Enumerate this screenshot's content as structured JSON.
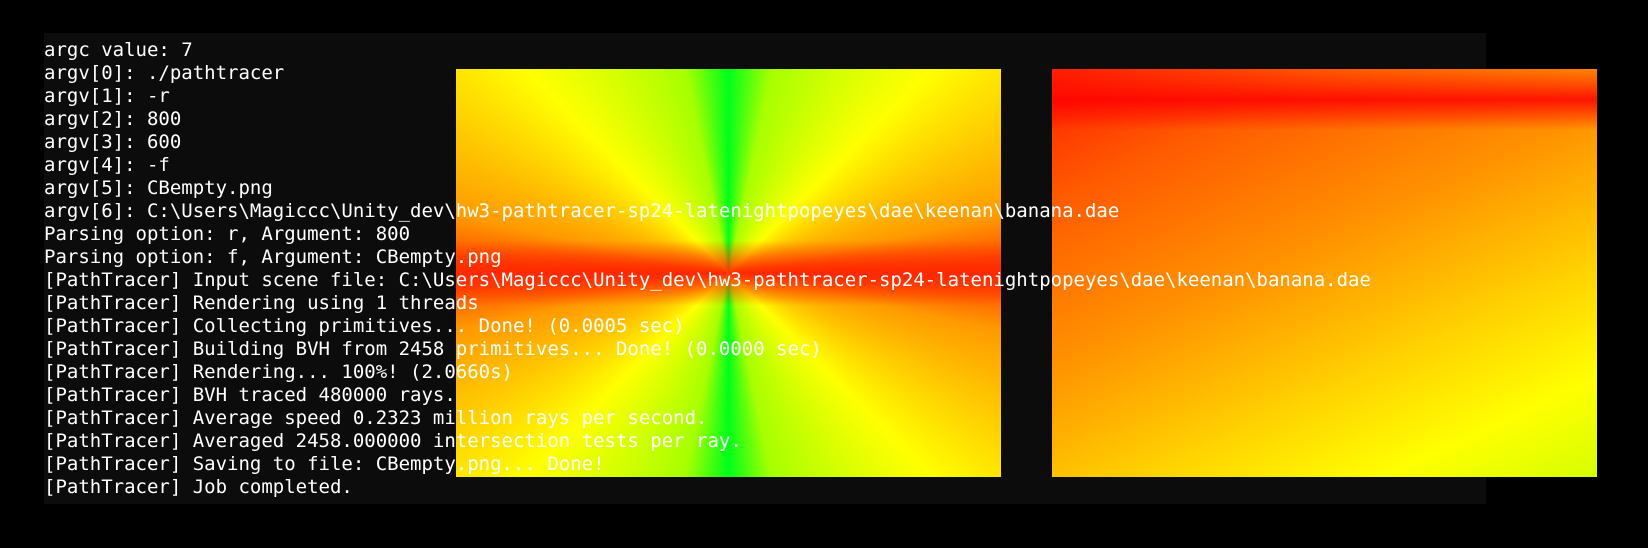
{
  "terminal": {
    "lines": [
      "argc value: 7",
      "argv[0]: ./pathtracer",
      "argv[1]: -r",
      "argv[2]: 800",
      "argv[3]: 600",
      "argv[4]: -f",
      "argv[5]: CBempty.png",
      "argv[6]: C:\\Users\\Magiccc\\Unity_dev\\hw3-pathtracer-sp24-latenightpopeyes\\dae\\keenan\\banana.dae",
      "Parsing option: r, Argument: 800",
      "Parsing option: f, Argument: CBempty.png",
      "[PathTracer] Input scene file: C:\\Users\\Magiccc\\Unity_dev\\hw3-pathtracer-sp24-latenightpopeyes\\dae\\keenan\\banana.dae",
      "[PathTracer] Rendering using 1 threads",
      "[PathTracer] Collecting primitives... Done! (0.0005 sec)",
      "[PathTracer] Building BVH from 2458 primitives... Done! (0.0000 sec)",
      "[PathTracer] Rendering... 100%! (2.0660s)",
      "[PathTracer] BVH traced 480000 rays.",
      "[PathTracer] Average speed 0.2323 million rays per second.",
      "[PathTracer] Averaged 2458.000000 intersection tests per ray.",
      "[PathTracer] Saving to file: CBempty.png... Done!",
      "[PathTracer] Job completed."
    ]
  },
  "colors": {
    "page_background": "#000000",
    "terminal_background": "#0c0c0c",
    "terminal_text": "#ffffff"
  }
}
